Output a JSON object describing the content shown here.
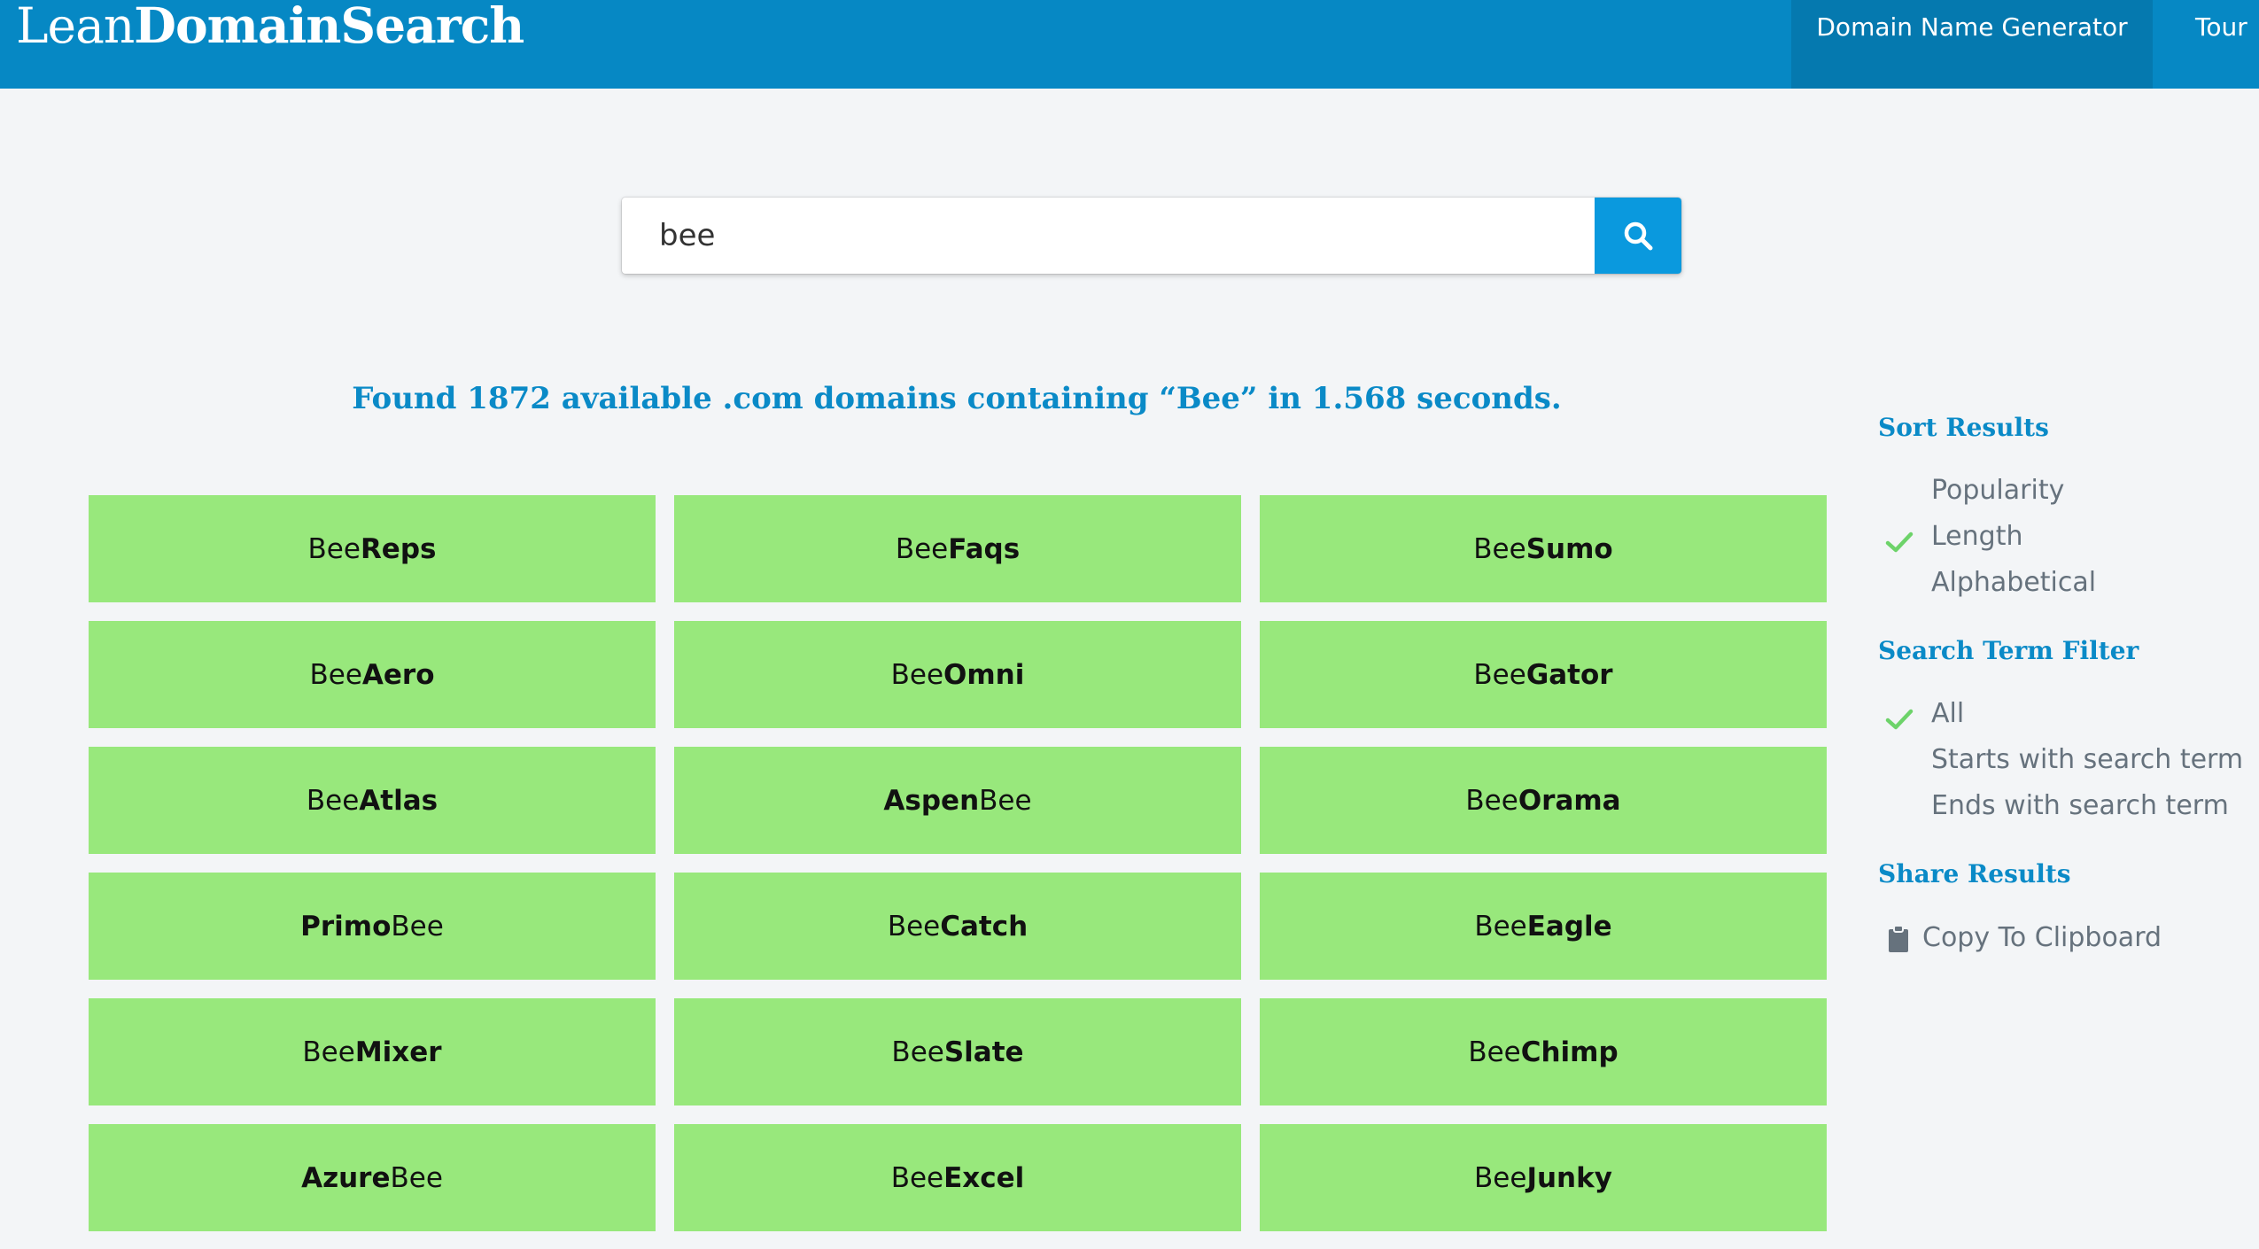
{
  "header": {
    "logo_light": "Lean",
    "logo_bold": "DomainSearch",
    "nav": {
      "generator": "Domain Name Generator",
      "tour": "Tour"
    }
  },
  "search": {
    "value": "bee",
    "button_icon": "search-icon"
  },
  "results": {
    "summary": "Found 1872 available .com domains containing “Bee” in 1.568 seconds.",
    "domains": [
      {
        "plain_first": "Bee",
        "bold": "Reps",
        "plain_last": ""
      },
      {
        "plain_first": "Bee",
        "bold": "Faqs",
        "plain_last": ""
      },
      {
        "plain_first": "Bee",
        "bold": "Sumo",
        "plain_last": ""
      },
      {
        "plain_first": "Bee",
        "bold": "Aero",
        "plain_last": ""
      },
      {
        "plain_first": "Bee",
        "bold": "Omni",
        "plain_last": ""
      },
      {
        "plain_first": "Bee",
        "bold": "Gator",
        "plain_last": ""
      },
      {
        "plain_first": "Bee",
        "bold": "Atlas",
        "plain_last": ""
      },
      {
        "plain_first": "",
        "bold": "Aspen",
        "plain_last": "Bee"
      },
      {
        "plain_first": "Bee",
        "bold": "Orama",
        "plain_last": ""
      },
      {
        "plain_first": "",
        "bold": "Primo",
        "plain_last": "Bee"
      },
      {
        "plain_first": "Bee",
        "bold": "Catch",
        "plain_last": ""
      },
      {
        "plain_first": "Bee",
        "bold": "Eagle",
        "plain_last": ""
      },
      {
        "plain_first": "Bee",
        "bold": "Mixer",
        "plain_last": ""
      },
      {
        "plain_first": "Bee",
        "bold": "Slate",
        "plain_last": ""
      },
      {
        "plain_first": "Bee",
        "bold": "Chimp",
        "plain_last": ""
      },
      {
        "plain_first": "",
        "bold": "Azure",
        "plain_last": "Bee"
      },
      {
        "plain_first": "Bee",
        "bold": "Excel",
        "plain_last": ""
      },
      {
        "plain_first": "Bee",
        "bold": "Junky",
        "plain_last": ""
      }
    ]
  },
  "sidebar": {
    "sort": {
      "title": "Sort Results",
      "options": [
        "Popularity",
        "Length",
        "Alphabetical"
      ],
      "selected": "Length"
    },
    "filter": {
      "title": "Search Term Filter",
      "options": [
        "All",
        "Starts with search term",
        "Ends with search term"
      ],
      "selected": "All"
    },
    "share": {
      "title": "Share Results",
      "copy_label": "Copy To Clipboard"
    }
  },
  "colors": {
    "header": "#0688c4",
    "accent": "#0a8ac7",
    "tile": "#98e87c",
    "check": "#6dd36a"
  }
}
